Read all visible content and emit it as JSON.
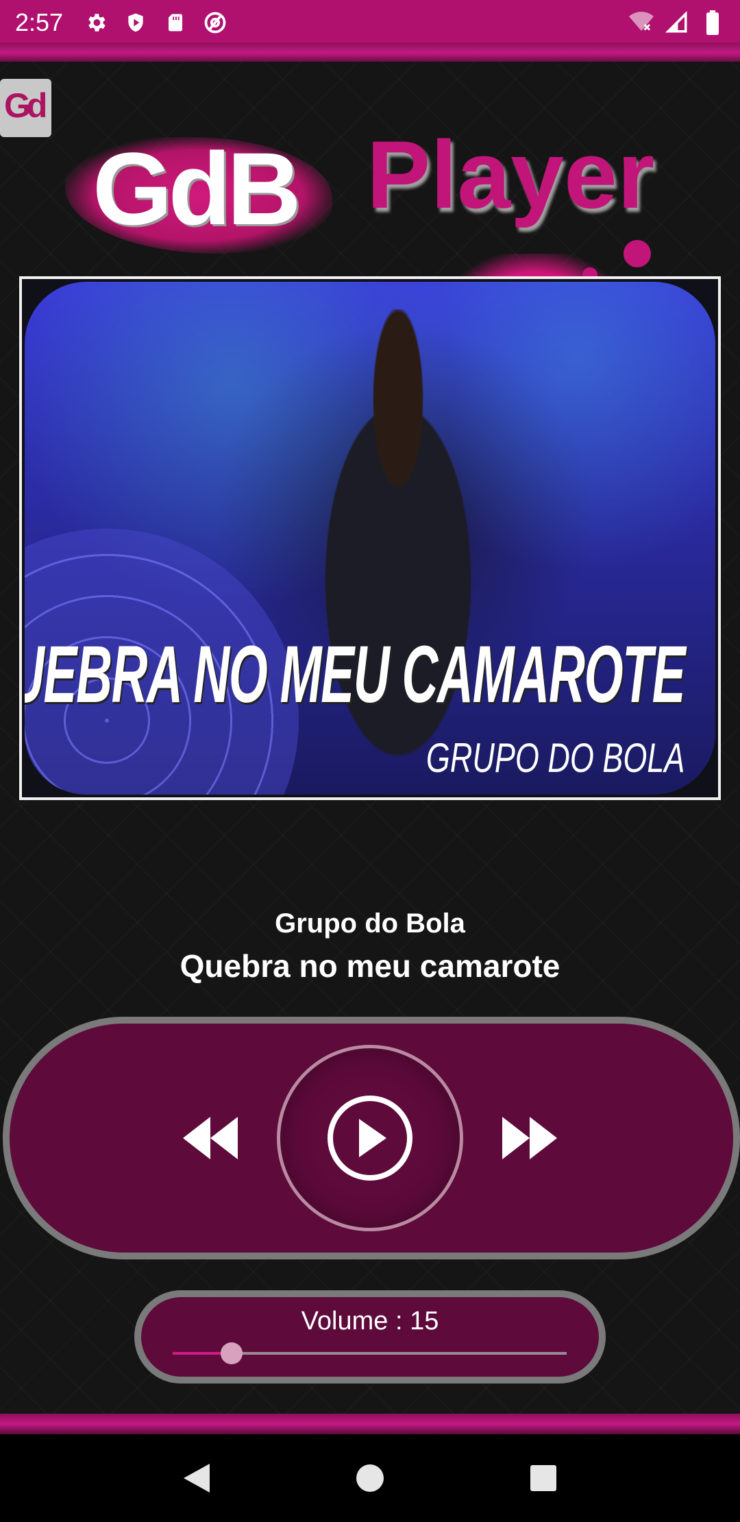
{
  "status_bar": {
    "time": "2:57",
    "icons_left": [
      "gear-icon",
      "shield-icon",
      "sd-card-icon",
      "at-sign-icon"
    ],
    "icons_right": [
      "wifi-icon",
      "signal-icon",
      "battery-icon"
    ],
    "color": "#b0106e"
  },
  "header": {
    "logo_text": "GdB",
    "title": "Player",
    "accent_color": "#c2157a"
  },
  "album_art": {
    "title": "QUEBRA NO MEU CAMAROTE",
    "subtitle": "GRUPO DO BOLA"
  },
  "track": {
    "artist": "Grupo do Bola",
    "title": "Quebra no meu camarote"
  },
  "controls": {
    "rewind_icon": "rewind-icon",
    "play_icon": "play-icon",
    "forward_icon": "fast-forward-icon",
    "panel_color": "#5e0a3b"
  },
  "volume": {
    "label": "Volume : 15",
    "level_fraction": 0.15
  },
  "nav_bar": {
    "icons": [
      "back-icon",
      "home-icon",
      "recents-icon"
    ]
  }
}
